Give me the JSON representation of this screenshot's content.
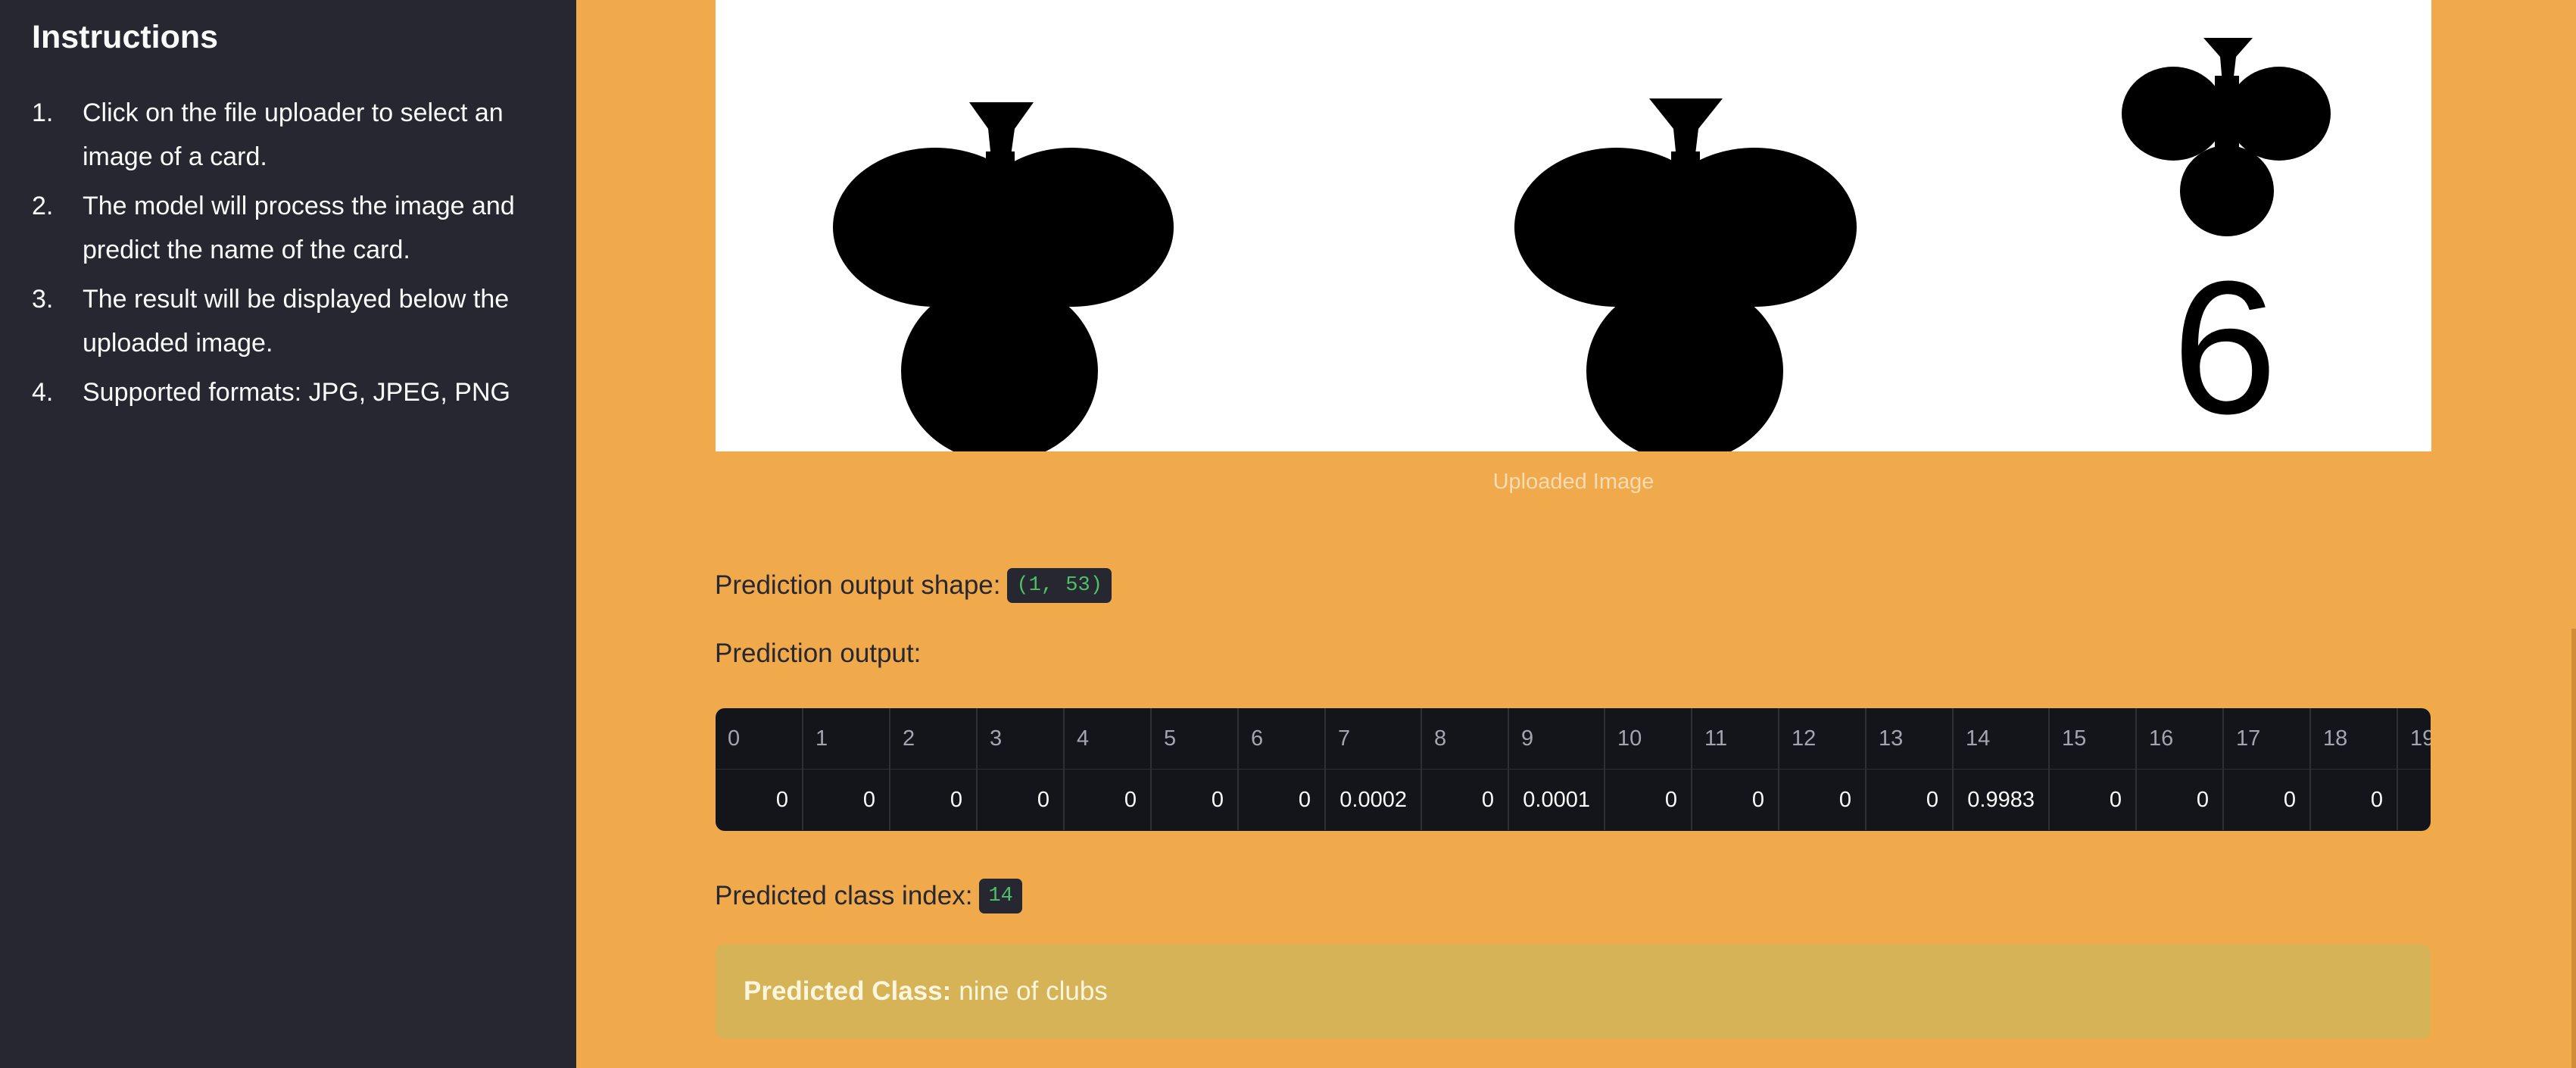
{
  "sidebar": {
    "title": "Instructions",
    "items": [
      {
        "num": "1.",
        "text": "Click on the file uploader to select an image of a card."
      },
      {
        "num": "2.",
        "text": "The model will process the image and predict the name of the card."
      },
      {
        "num": "3.",
        "text": "The result will be displayed below the uploaded image."
      },
      {
        "num": "4.",
        "text": "Supported formats: JPG, JPEG, PNG"
      }
    ]
  },
  "image": {
    "caption": "Uploaded Image",
    "card_rank": "6",
    "icons": [
      "club-icon",
      "club-icon",
      "club-icon"
    ]
  },
  "prediction": {
    "shape_label": "Prediction output shape:",
    "shape_value": "(1, 53)",
    "output_label": "Prediction output:",
    "table": {
      "headers": [
        "0",
        "1",
        "2",
        "3",
        "4",
        "5",
        "6",
        "7",
        "8",
        "9",
        "10",
        "11",
        "12",
        "13",
        "14",
        "15",
        "16",
        "17",
        "18",
        "19"
      ],
      "values": [
        "0",
        "0",
        "0",
        "0",
        "0",
        "0",
        "0",
        "0.0002",
        "0",
        "0.0001",
        "0",
        "0",
        "0",
        "0",
        "0.9983",
        "0",
        "0",
        "0",
        "0",
        ""
      ]
    },
    "index_label": "Predicted class index:",
    "index_value": "14",
    "class_label": "Predicted Class:",
    "class_value": "nine of clubs"
  },
  "colors": {
    "sidebar_bg": "#262730",
    "main_bg": "#f0a94b",
    "table_bg": "#14151b",
    "code_text": "#4fbf68",
    "result_bg": "#d5b356"
  }
}
